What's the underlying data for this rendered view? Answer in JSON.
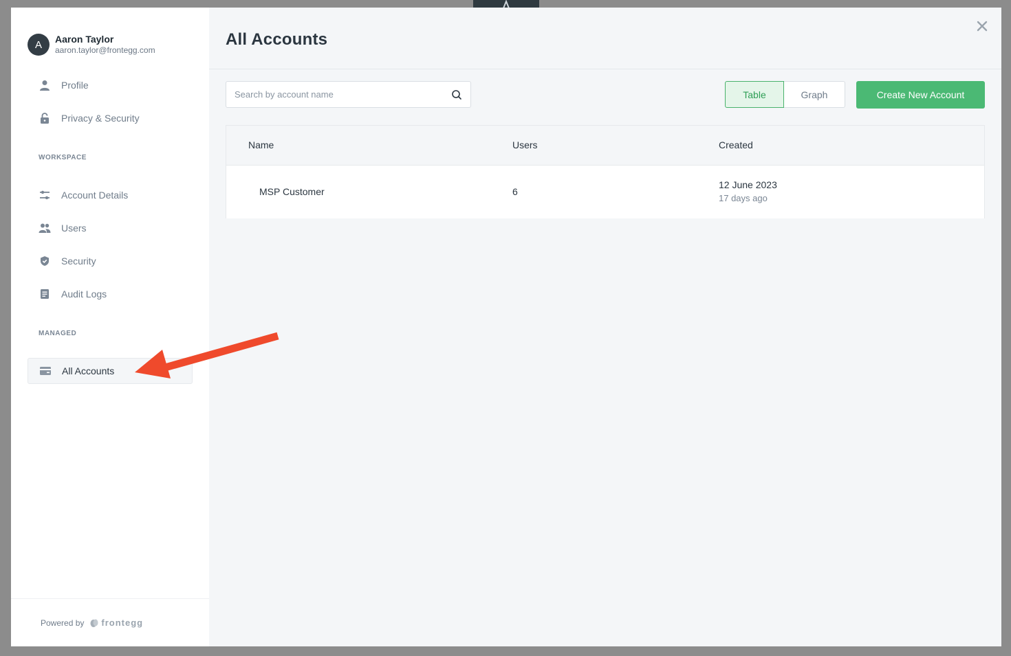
{
  "user": {
    "initial": "A",
    "name": "Aaron Taylor",
    "email": "aaron.taylor@frontegg.com"
  },
  "nav": {
    "profile": "Profile",
    "privacy_security": "Privacy & Security",
    "workspace_label": "WORKSPACE",
    "account_details": "Account Details",
    "users": "Users",
    "security": "Security",
    "audit_logs": "Audit Logs",
    "managed_label": "MANAGED",
    "all_accounts": "All Accounts"
  },
  "footer": {
    "powered_by": "Powered by",
    "brand": "frontegg"
  },
  "main": {
    "title": "All Accounts",
    "search_placeholder": "Search by account name",
    "view_toggle": {
      "table": "Table",
      "graph": "Graph",
      "selected": "Table"
    },
    "create_button": "Create New Account"
  },
  "table": {
    "headers": {
      "name": "Name",
      "users": "Users",
      "created": "Created"
    },
    "rows": [
      {
        "name": "MSP Customer",
        "users": "6",
        "created_date": "12 June 2023",
        "created_relative": "17 days ago"
      }
    ]
  },
  "colors": {
    "accent_green": "#4bb974",
    "annotation_arrow": "#ef4a2c",
    "avatar_bg": "#333d45"
  },
  "icons": {
    "profile": "person-icon",
    "privacy_security": "lock-icon",
    "account_details": "sliders-icon",
    "users": "users-icon",
    "security": "shield-icon",
    "audit_logs": "document-icon",
    "all_accounts": "card-icon",
    "search": "search-icon",
    "close": "close-icon"
  }
}
